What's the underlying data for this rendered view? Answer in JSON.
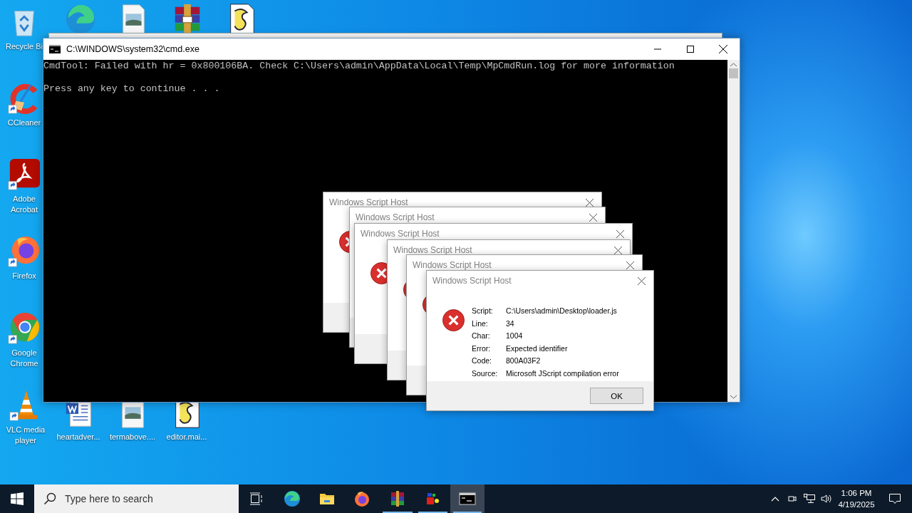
{
  "desktop_icons": [
    {
      "label": "Recycle Bi"
    },
    {
      "label": "CCleaner"
    },
    {
      "label": "Adobe Acrobat"
    },
    {
      "label": "Firefox"
    },
    {
      "label": "Google Chrome"
    },
    {
      "label": "VLC media player"
    },
    {
      "label": "heartadver..."
    },
    {
      "label": "termabove...."
    },
    {
      "label": "editor.mai..."
    }
  ],
  "console_window": {
    "title": "C:\\WINDOWS\\system32\\cmd.exe",
    "lines": [
      "CmdTool: Failed with hr = 0x800106BA. Check C:\\Users\\admin\\AppData\\Local\\Temp\\MpCmdRun.log for more information",
      "Press any key to continue . . ."
    ]
  },
  "dialogs": [
    {
      "title": "Windows Script Host"
    },
    {
      "title": "Windows Script Host"
    },
    {
      "title": "Windows Script Host"
    },
    {
      "title": "Windows Script Host"
    },
    {
      "title": "Windows Script Host"
    },
    {
      "title": "Windows Script Host",
      "fields": [
        {
          "label": "Script:",
          "value": "C:\\Users\\admin\\Desktop\\loader.js"
        },
        {
          "label": "Line:",
          "value": "34"
        },
        {
          "label": "Char:",
          "value": "1004"
        },
        {
          "label": "Error:",
          "value": "Expected identifier"
        },
        {
          "label": "Code:",
          "value": "800A03F2"
        },
        {
          "label": "Source:",
          "value": "Microsoft JScript compilation error"
        }
      ],
      "button": "OK"
    }
  ],
  "taskbar": {
    "search": {
      "placeholder": "Type here to search"
    },
    "apps": [
      {
        "running": false,
        "selected": false
      },
      {
        "running": false,
        "selected": false
      },
      {
        "running": false,
        "selected": false
      },
      {
        "running": true,
        "selected": false
      },
      {
        "running": true,
        "selected": false
      },
      {
        "running": true,
        "selected": true
      }
    ],
    "clock": {
      "time": "1:06 PM",
      "date": "4/19/2025"
    }
  }
}
